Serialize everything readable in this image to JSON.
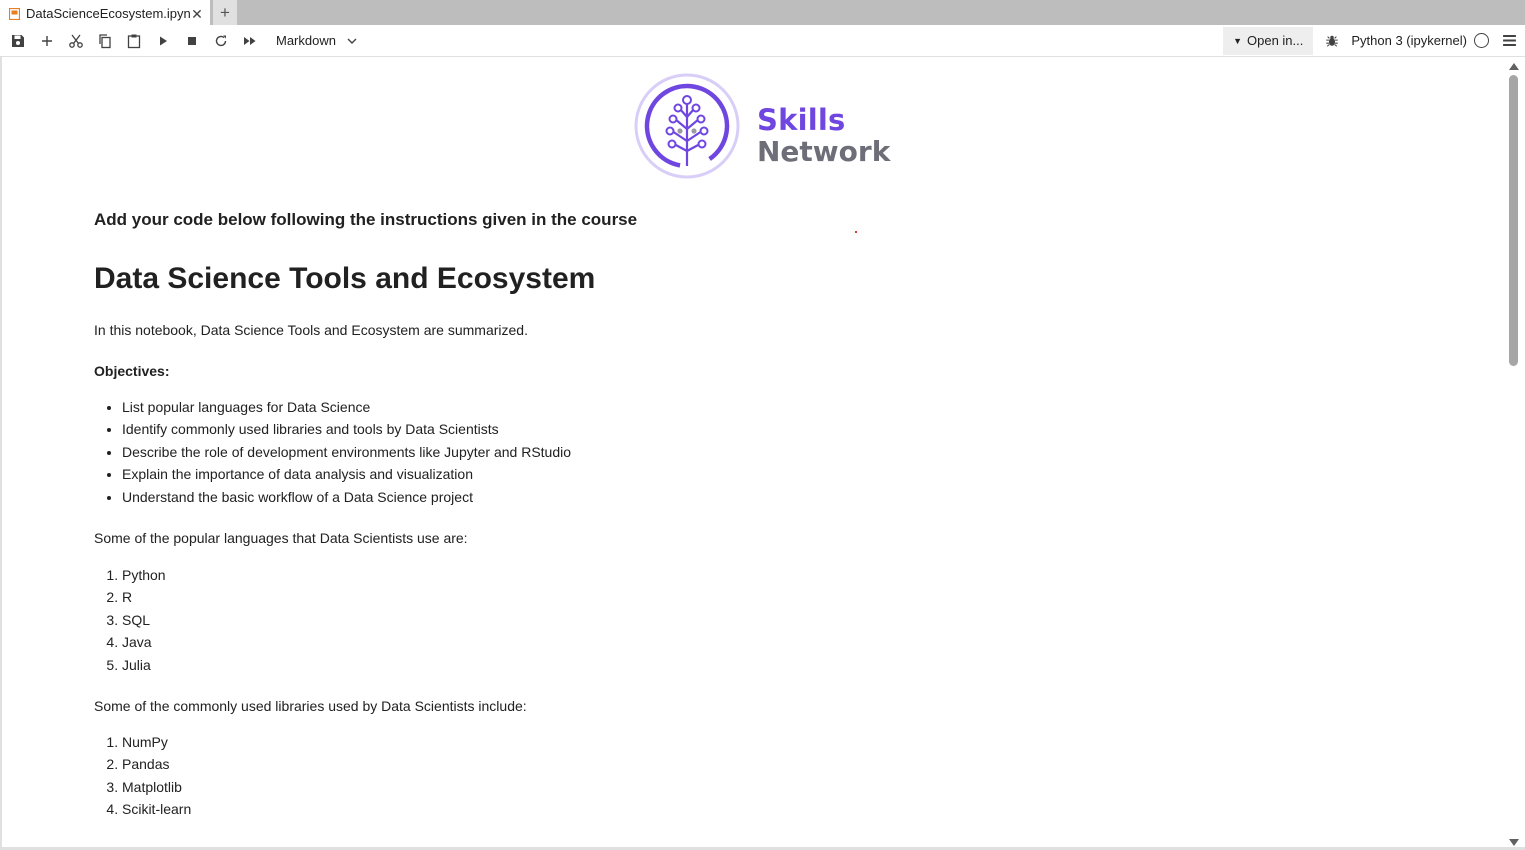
{
  "tab": {
    "title": "DataScienceEcosystem.ipynb",
    "close_glyph": "✕",
    "new_glyph": "+"
  },
  "toolbar": {
    "cell_type": "Markdown",
    "open_in": "Open in...",
    "kernel_name": "Python 3 (ipykernel)",
    "accent_color": "#e67e22"
  },
  "logo": {
    "line1": "Skills",
    "line2": "Network",
    "colors": {
      "purple": "#6f46e0",
      "gray": "#6e6e78",
      "ring": "#d8cef8"
    }
  },
  "notebook": {
    "instruction_heading": "Add your code below following the instructions given in the course",
    "title": "Data Science Tools and Ecosystem",
    "intro": "In this notebook, Data Science Tools and Ecosystem are summarized.",
    "objectives_label": "Objectives:",
    "objectives": [
      "List popular languages for Data Science",
      "Identify commonly used libraries and tools by Data Scientists",
      "Describe the role of development environments like Jupyter and RStudio",
      "Explain the importance of data analysis and visualization",
      "Understand the basic workflow of a Data Science project"
    ],
    "languages_intro": "Some of the popular languages that Data Scientists use are:",
    "languages": [
      "Python",
      "R",
      "SQL",
      "Java",
      "Julia"
    ],
    "libraries_intro": "Some of the commonly used libraries used by Data Scientists include:",
    "libraries": [
      "NumPy",
      "Pandas",
      "Matplotlib",
      "Scikit-learn"
    ]
  }
}
